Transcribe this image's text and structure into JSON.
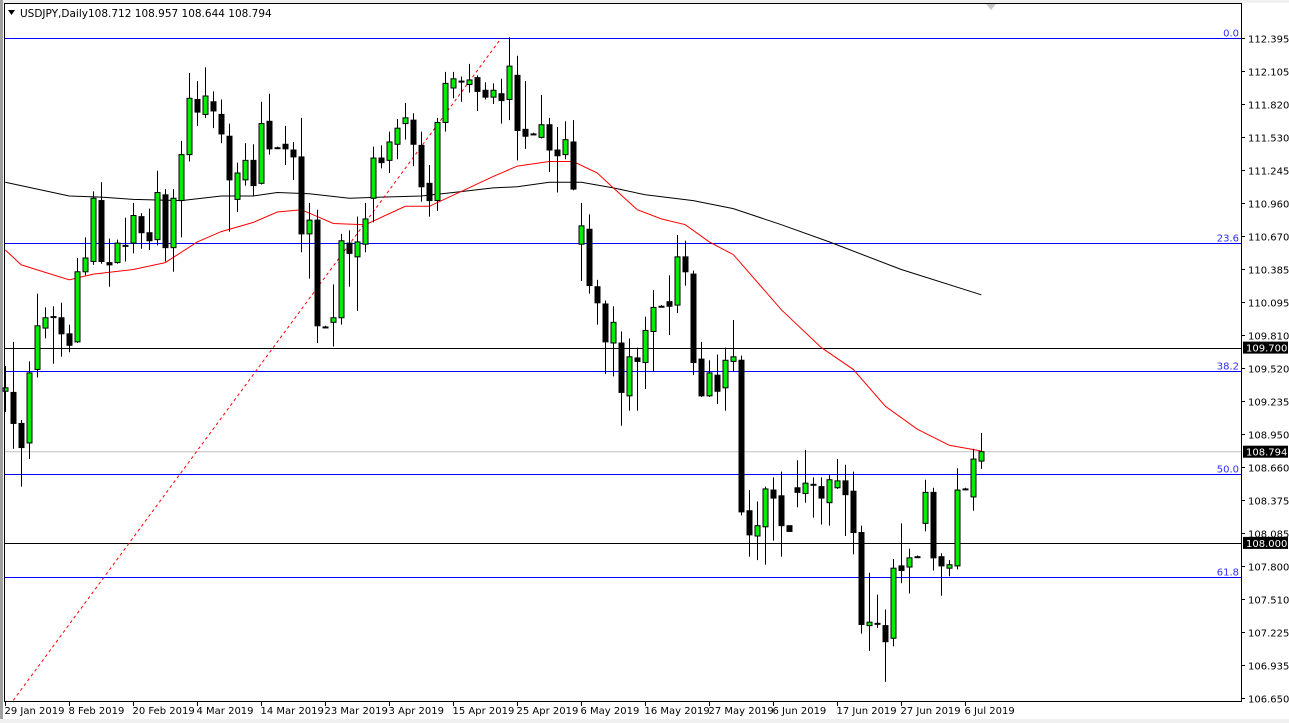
{
  "header": {
    "menu_icon": "triangle-down-icon",
    "symbol": "USDJPY,Daily",
    "ohlc_text": "108.712 108.957 108.644 108.794"
  },
  "colors": {
    "bull": "#00ee00",
    "bear": "#000000",
    "ma_fast": "#ff0000",
    "ma_slow": "#000000",
    "fib": "#0000ff",
    "level": "#000000",
    "bid_line": "#c0c0c0",
    "trendline": "#ff0000"
  },
  "chart_data": {
    "type": "candlestick",
    "title": "USDJPY,Daily",
    "ylim": [
      106.65,
      112.395
    ],
    "price_ticks": [
      "112.395",
      "112.105",
      "111.820",
      "111.530",
      "111.245",
      "110.960",
      "110.670",
      "110.385",
      "110.095",
      "109.810",
      "109.520",
      "109.235",
      "108.950",
      "108.660",
      "108.375",
      "108.085",
      "107.800",
      "107.510",
      "107.225",
      "106.935",
      "106.650"
    ],
    "date_ticks": [
      {
        "bar": 0,
        "label": "29 Jan 2019"
      },
      {
        "bar": 8,
        "label": "8 Feb 2019"
      },
      {
        "bar": 16,
        "label": "20 Feb 2019"
      },
      {
        "bar": 24,
        "label": "4 Mar 2019"
      },
      {
        "bar": 32,
        "label": "14 Mar 2019"
      },
      {
        "bar": 40,
        "label": "23 Mar 2019"
      },
      {
        "bar": 48,
        "label": "3 Apr 2019"
      },
      {
        "bar": 56,
        "label": "15 Apr 2019"
      },
      {
        "bar": 64,
        "label": "25 Apr 2019"
      },
      {
        "bar": 72,
        "label": "6 May 2019"
      },
      {
        "bar": 80,
        "label": "16 May 2019"
      },
      {
        "bar": 88,
        "label": "27 May 2019"
      },
      {
        "bar": 96,
        "label": "6 Jun 2019"
      },
      {
        "bar": 104,
        "label": "17 Jun 2019"
      },
      {
        "bar": 112,
        "label": "27 Jun 2019"
      },
      {
        "bar": 120,
        "label": "6 Jul 2019"
      }
    ],
    "ohlc_columns": [
      "open",
      "high",
      "low",
      "close"
    ],
    "candles": [
      [
        109.32,
        109.54,
        109.14,
        109.35
      ],
      [
        109.31,
        109.75,
        108.82,
        109.04
      ],
      [
        109.04,
        109.07,
        108.49,
        108.83
      ],
      [
        108.87,
        109.58,
        108.73,
        109.48
      ],
      [
        109.51,
        110.17,
        109.44,
        109.89
      ],
      [
        109.87,
        110.05,
        109.78,
        109.96
      ],
      [
        109.97,
        110.06,
        109.56,
        109.97
      ],
      [
        109.96,
        110.09,
        109.62,
        109.82
      ],
      [
        109.82,
        109.9,
        109.66,
        109.72
      ],
      [
        109.75,
        110.48,
        109.74,
        110.36
      ],
      [
        110.36,
        110.66,
        110.33,
        110.48
      ],
      [
        110.45,
        111.06,
        110.42,
        111.0
      ],
      [
        110.98,
        111.14,
        110.43,
        110.45
      ],
      [
        110.44,
        110.65,
        110.23,
        110.42
      ],
      [
        110.44,
        110.64,
        110.43,
        110.61
      ],
      [
        110.59,
        110.83,
        110.45,
        110.59
      ],
      [
        110.61,
        110.96,
        110.52,
        110.85
      ],
      [
        110.84,
        110.87,
        110.56,
        110.7
      ],
      [
        110.7,
        110.91,
        110.55,
        110.63
      ],
      [
        110.64,
        111.24,
        110.59,
        111.05
      ],
      [
        111.03,
        111.08,
        110.45,
        110.57
      ],
      [
        110.57,
        111.08,
        110.36,
        111.0
      ],
      [
        110.98,
        111.5,
        110.66,
        111.38
      ],
      [
        111.38,
        112.09,
        111.32,
        111.87
      ],
      [
        111.86,
        112.02,
        111.63,
        111.75
      ],
      [
        111.73,
        112.14,
        111.7,
        111.89
      ],
      [
        111.84,
        111.93,
        111.61,
        111.76
      ],
      [
        111.73,
        111.86,
        111.48,
        111.56
      ],
      [
        111.54,
        111.65,
        110.71,
        111.16
      ],
      [
        110.99,
        111.31,
        110.88,
        111.22
      ],
      [
        111.16,
        111.48,
        111.11,
        111.33
      ],
      [
        111.33,
        111.47,
        111.02,
        111.11
      ],
      [
        111.13,
        111.84,
        111.12,
        111.65
      ],
      [
        111.67,
        111.91,
        111.38,
        111.43
      ],
      [
        111.44,
        111.45,
        111.43,
        111.44
      ],
      [
        111.47,
        111.63,
        111.29,
        111.43
      ],
      [
        111.42,
        111.49,
        111.16,
        111.36
      ],
      [
        111.36,
        111.7,
        110.53,
        110.69
      ],
      [
        110.69,
        110.96,
        110.3,
        110.81
      ],
      [
        110.81,
        110.9,
        109.74,
        109.89
      ],
      [
        109.88,
        109.89,
        109.87,
        109.88
      ],
      [
        109.92,
        110.25,
        109.71,
        109.96
      ],
      [
        109.96,
        110.69,
        109.9,
        110.63
      ],
      [
        110.61,
        110.72,
        110.23,
        110.52
      ],
      [
        110.49,
        110.84,
        110.02,
        110.62
      ],
      [
        110.6,
        110.96,
        110.53,
        110.82
      ],
      [
        111.0,
        111.45,
        110.79,
        111.35
      ],
      [
        111.35,
        111.46,
        111.26,
        111.31
      ],
      [
        111.33,
        111.58,
        111.22,
        111.49
      ],
      [
        111.47,
        111.69,
        111.34,
        111.61
      ],
      [
        111.65,
        111.83,
        111.51,
        111.7
      ],
      [
        111.68,
        111.74,
        111.28,
        111.47
      ],
      [
        111.46,
        111.58,
        110.97,
        111.1
      ],
      [
        111.13,
        111.29,
        110.84,
        110.98
      ],
      [
        110.98,
        111.7,
        110.89,
        111.66
      ],
      [
        111.66,
        112.1,
        111.58,
        112.0
      ],
      [
        111.96,
        112.1,
        111.87,
        112.04
      ],
      [
        112.02,
        112.06,
        111.84,
        112.02
      ],
      [
        111.99,
        112.17,
        111.92,
        112.03
      ],
      [
        112.05,
        112.07,
        111.76,
        111.93
      ],
      [
        111.94,
        112.01,
        111.86,
        111.88
      ],
      [
        111.88,
        112.0,
        111.82,
        111.94
      ],
      [
        111.91,
        112.04,
        111.65,
        111.85
      ],
      [
        111.86,
        112.4,
        111.68,
        112.15
      ],
      [
        112.07,
        112.24,
        111.33,
        111.59
      ],
      [
        111.6,
        112.02,
        111.43,
        111.54
      ],
      [
        111.56,
        111.57,
        111.55,
        111.56
      ],
      [
        111.53,
        111.9,
        111.52,
        111.64
      ],
      [
        111.64,
        111.7,
        111.23,
        111.42
      ],
      [
        111.42,
        111.62,
        111.05,
        111.37
      ],
      [
        111.38,
        111.67,
        111.34,
        111.51
      ],
      [
        111.49,
        111.68,
        111.07,
        111.08
      ],
      [
        110.6,
        110.96,
        110.28,
        110.76
      ],
      [
        110.73,
        110.86,
        110.17,
        110.24
      ],
      [
        110.23,
        110.29,
        109.9,
        110.09
      ],
      [
        110.08,
        110.11,
        109.47,
        109.75
      ],
      [
        109.74,
        110.06,
        109.45,
        109.92
      ],
      [
        109.74,
        109.84,
        109.02,
        109.31
      ],
      [
        109.28,
        109.78,
        109.15,
        109.62
      ],
      [
        109.61,
        109.7,
        109.15,
        109.58
      ],
      [
        109.57,
        109.97,
        109.34,
        109.85
      ],
      [
        109.84,
        110.2,
        109.49,
        110.05
      ],
      [
        110.06,
        110.07,
        110.05,
        110.06
      ],
      [
        110.1,
        110.33,
        109.81,
        110.06
      ],
      [
        110.07,
        110.68,
        110.0,
        110.49
      ],
      [
        110.49,
        110.63,
        110.24,
        110.36
      ],
      [
        110.34,
        110.37,
        109.46,
        109.57
      ],
      [
        109.6,
        109.75,
        109.27,
        109.28
      ],
      [
        109.28,
        109.59,
        109.27,
        109.48
      ],
      [
        109.46,
        109.64,
        109.21,
        109.32
      ],
      [
        109.35,
        109.7,
        109.15,
        109.59
      ],
      [
        109.58,
        109.94,
        109.49,
        109.62
      ],
      [
        109.59,
        109.63,
        108.24,
        108.27
      ],
      [
        108.28,
        108.46,
        107.88,
        108.07
      ],
      [
        108.06,
        108.36,
        107.85,
        108.15
      ],
      [
        108.14,
        108.49,
        107.81,
        108.47
      ],
      [
        108.46,
        108.57,
        108.02,
        108.39
      ],
      [
        108.41,
        108.62,
        107.88,
        108.15
      ],
      [
        108.15,
        108.15,
        108.1,
        108.1
      ],
      [
        108.48,
        108.72,
        108.31,
        108.44
      ],
      [
        108.43,
        108.81,
        108.35,
        108.52
      ],
      [
        108.51,
        108.57,
        108.22,
        108.51
      ],
      [
        108.49,
        108.57,
        108.16,
        108.39
      ],
      [
        108.35,
        108.59,
        108.15,
        108.55
      ],
      [
        108.48,
        108.73,
        108.47,
        108.54
      ],
      [
        108.54,
        108.68,
        108.06,
        108.42
      ],
      [
        108.45,
        108.62,
        107.9,
        108.09
      ],
      [
        108.09,
        108.15,
        107.21,
        107.29
      ],
      [
        107.28,
        107.74,
        107.06,
        107.31
      ],
      [
        107.3,
        107.55,
        107.26,
        107.3
      ],
      [
        107.28,
        107.42,
        106.79,
        107.14
      ],
      [
        107.17,
        107.86,
        107.1,
        107.78
      ],
      [
        107.8,
        108.17,
        107.65,
        107.76
      ],
      [
        107.79,
        107.95,
        107.56,
        107.87
      ],
      [
        107.88,
        107.89,
        107.87,
        107.88
      ],
      [
        108.17,
        108.55,
        108.1,
        108.44
      ],
      [
        108.44,
        108.48,
        107.76,
        107.87
      ],
      [
        107.88,
        107.91,
        107.54,
        107.8
      ],
      [
        107.78,
        107.85,
        107.71,
        107.81
      ],
      [
        107.8,
        108.65,
        107.77,
        108.46
      ],
      [
        108.47,
        108.48,
        108.46,
        108.47
      ],
      [
        108.4,
        108.82,
        108.28,
        108.73
      ],
      [
        108.712,
        108.957,
        108.644,
        108.794
      ]
    ],
    "ma_fast": [
      [
        0,
        110.55
      ],
      [
        2,
        110.42
      ],
      [
        8,
        110.29
      ],
      [
        11,
        110.34
      ],
      [
        16,
        110.38
      ],
      [
        20,
        110.44
      ],
      [
        24,
        110.62
      ],
      [
        27,
        110.71
      ],
      [
        31,
        110.79
      ],
      [
        34,
        110.88
      ],
      [
        37,
        110.9
      ],
      [
        39,
        110.84
      ],
      [
        41,
        110.78
      ],
      [
        45,
        110.77
      ],
      [
        50,
        110.93
      ],
      [
        53,
        110.93
      ],
      [
        57,
        111.06
      ],
      [
        61,
        111.19
      ],
      [
        64,
        111.28
      ],
      [
        68,
        111.32
      ],
      [
        71,
        111.32
      ],
      [
        74,
        111.22
      ],
      [
        76,
        111.09
      ],
      [
        79,
        110.9
      ],
      [
        82,
        110.82
      ],
      [
        85,
        110.77
      ],
      [
        88,
        110.62
      ],
      [
        91,
        110.51
      ],
      [
        97,
        110.03
      ],
      [
        102,
        109.7
      ],
      [
        106,
        109.51
      ],
      [
        110,
        109.19
      ],
      [
        114,
        108.99
      ],
      [
        118,
        108.85
      ],
      [
        122,
        108.8
      ]
    ],
    "ma_slow": [
      [
        0,
        111.14
      ],
      [
        4,
        111.08
      ],
      [
        8,
        111.02
      ],
      [
        12,
        111.01
      ],
      [
        16,
        110.99
      ],
      [
        22,
        110.98
      ],
      [
        27,
        111.02
      ],
      [
        31,
        111.02
      ],
      [
        34,
        111.05
      ],
      [
        38,
        111.04
      ],
      [
        43,
        111.0
      ],
      [
        47,
        111.01
      ],
      [
        52,
        111.02
      ],
      [
        56,
        111.05
      ],
      [
        61,
        111.09
      ],
      [
        64,
        111.1
      ],
      [
        68,
        111.14
      ],
      [
        72,
        111.14
      ],
      [
        76,
        111.09
      ],
      [
        80,
        111.03
      ],
      [
        86,
        110.98
      ],
      [
        91,
        110.91
      ],
      [
        97,
        110.77
      ],
      [
        103,
        110.62
      ],
      [
        112,
        110.38
      ],
      [
        122,
        110.16
      ]
    ],
    "fib_levels": [
      {
        "label": "0.0",
        "price": 112.395
      },
      {
        "label": "23.6",
        "price": 110.61
      },
      {
        "label": "38.2",
        "price": 109.5
      },
      {
        "label": "50.0",
        "price": 108.6
      },
      {
        "label": "61.8",
        "price": 107.7
      }
    ],
    "horizontal_levels": [
      {
        "label": "109.700",
        "price": 109.7
      },
      {
        "label": "108.000",
        "price": 108.0
      }
    ],
    "bid": {
      "label": "108.794",
      "price": 108.794
    },
    "trendline": {
      "from": [
        1,
        106.63
      ],
      "to": [
        62,
        112.395
      ]
    }
  }
}
